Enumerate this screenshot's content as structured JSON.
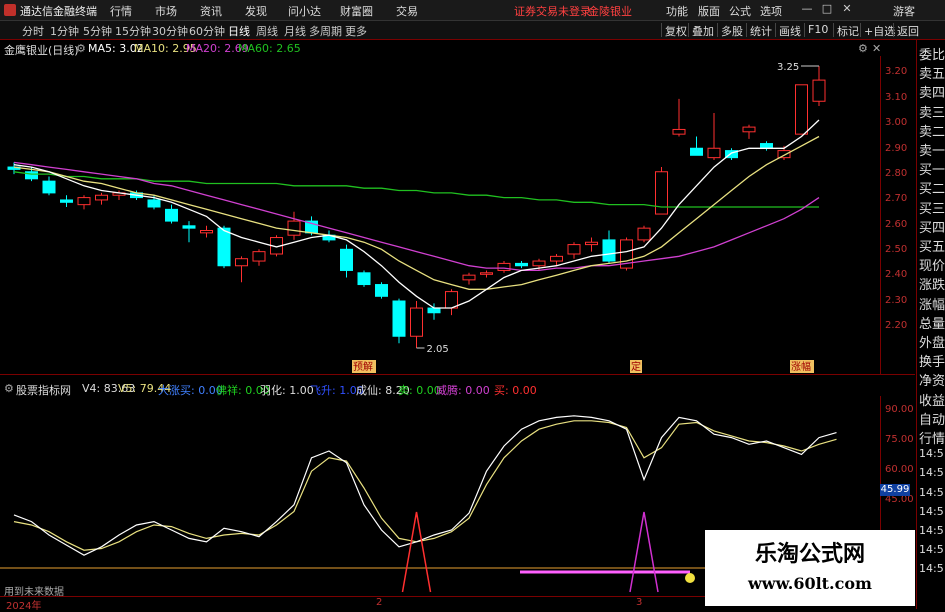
{
  "titlebar": {
    "app_name": "通达信金融终端",
    "menus": [
      "行情",
      "市场",
      "资讯",
      "发现",
      "问小达",
      "财富圈",
      "交易"
    ],
    "warning": "证券交易未登录",
    "stock_name": "金陵银业",
    "right_menus": [
      "功能",
      "版面",
      "公式",
      "选项"
    ],
    "toolbar_label": "游客"
  },
  "periods": {
    "items": [
      "分时",
      "1分钟",
      "5分钟",
      "15分钟",
      "30分钟",
      "60分钟",
      "日线",
      "周线",
      "月线",
      "多周期",
      "更多"
    ],
    "active": "日线"
  },
  "right_toolbar": [
    "复权",
    "叠加",
    "多股",
    "统计",
    "画线",
    "F10",
    "标记",
    "+自选",
    "返回"
  ],
  "main_info": {
    "title": "金鹰银业(日线)",
    "ma5": "MA5: 3.02",
    "ma10": "MA10: 2.95",
    "ma20": "MA20: 2.69",
    "ma60": "MA60: 2.65"
  },
  "colors": {
    "up": "#ff3030",
    "down": "#00ffff",
    "ma5": "#ffffff",
    "ma10": "#e8e080",
    "ma20": "#d040d0",
    "ma60": "#20c020"
  },
  "y_ticks_main": [
    "3.20",
    "3.10",
    "3.00",
    "2.90",
    "2.80",
    "2.70",
    "2.60",
    "2.50",
    "2.40",
    "2.30",
    "2.20"
  ],
  "annotations": {
    "high_label": "3.25",
    "low_label": "2.05",
    "badges": [
      "预解",
      "定",
      "涨幅"
    ]
  },
  "right_panel": [
    "委比",
    "卖五",
    "卖四",
    "卖三",
    "卖二",
    "卖一",
    "买一",
    "买二",
    "买三",
    "买四",
    "买五",
    "现价",
    "涨跌",
    "涨幅",
    "总量",
    "外盘",
    "换手",
    "净资",
    "收益",
    "自动",
    "行情",
    "14:5",
    "14:5",
    "14:5",
    "14:5",
    "14:5",
    "14:5",
    "14:5"
  ],
  "indicator_info": {
    "name": "股票指标网",
    "v4": "V4: 83.63",
    "v5": "V5: 79.44",
    "items": [
      {
        "label": "大涨买:",
        "value": "0.00",
        "color": "#4080ff"
      },
      {
        "label": "佛祥:",
        "value": "0.00",
        "color": "#20d020"
      },
      {
        "label": "羽化:",
        "value": "1.00",
        "color": "#dddddd"
      },
      {
        "label": "飞升:",
        "value": "1.00",
        "color": "#3050ff"
      },
      {
        "label": "成仙:",
        "value": "8.20",
        "color": "#dddddd"
      },
      {
        "label": "卖:",
        "value": "0.00",
        "color": "#20d020"
      },
      {
        "label": "威腾:",
        "value": "0.00",
        "color": "#d040d0"
      },
      {
        "label": "买:",
        "value": "0.00",
        "color": "#ff3030"
      }
    ]
  },
  "y_ticks_ind": [
    "90.00",
    "75.00",
    "60.00",
    "45.00"
  ],
  "current_value": "45.99",
  "dates": [
    "2024年",
    "2",
    "3"
  ],
  "no_data_text": "用到未来数据",
  "watermark": {
    "line1": "乐淘公式网",
    "line2": "www.60lt.com"
  },
  "chart_data": {
    "type": "candlestick",
    "title": "金鹰银业(日线)",
    "ylim": [
      2.05,
      3.25
    ],
    "candles": [
      {
        "o": 2.82,
        "h": 2.84,
        "l": 2.79,
        "c": 2.81
      },
      {
        "o": 2.8,
        "h": 2.82,
        "l": 2.76,
        "c": 2.77
      },
      {
        "o": 2.76,
        "h": 2.78,
        "l": 2.7,
        "c": 2.71
      },
      {
        "o": 2.68,
        "h": 2.7,
        "l": 2.65,
        "c": 2.67
      },
      {
        "o": 2.66,
        "h": 2.7,
        "l": 2.64,
        "c": 2.69
      },
      {
        "o": 2.68,
        "h": 2.71,
        "l": 2.66,
        "c": 2.7
      },
      {
        "o": 2.7,
        "h": 2.72,
        "l": 2.68,
        "c": 2.71
      },
      {
        "o": 2.71,
        "h": 2.72,
        "l": 2.68,
        "c": 2.69
      },
      {
        "o": 2.68,
        "h": 2.7,
        "l": 2.64,
        "c": 2.65
      },
      {
        "o": 2.64,
        "h": 2.66,
        "l": 2.58,
        "c": 2.59
      },
      {
        "o": 2.57,
        "h": 2.59,
        "l": 2.5,
        "c": 2.56
      },
      {
        "o": 2.54,
        "h": 2.57,
        "l": 2.52,
        "c": 2.55
      },
      {
        "o": 2.56,
        "h": 2.57,
        "l": 2.39,
        "c": 2.4
      },
      {
        "o": 2.4,
        "h": 2.44,
        "l": 2.33,
        "c": 2.43
      },
      {
        "o": 2.42,
        "h": 2.47,
        "l": 2.4,
        "c": 2.46
      },
      {
        "o": 2.45,
        "h": 2.53,
        "l": 2.44,
        "c": 2.52
      },
      {
        "o": 2.53,
        "h": 2.63,
        "l": 2.51,
        "c": 2.59
      },
      {
        "o": 2.59,
        "h": 2.61,
        "l": 2.53,
        "c": 2.54
      },
      {
        "o": 2.53,
        "h": 2.55,
        "l": 2.5,
        "c": 2.51
      },
      {
        "o": 2.47,
        "h": 2.49,
        "l": 2.35,
        "c": 2.38
      },
      {
        "o": 2.37,
        "h": 2.38,
        "l": 2.31,
        "c": 2.32
      },
      {
        "o": 2.32,
        "h": 2.33,
        "l": 2.26,
        "c": 2.27
      },
      {
        "o": 2.25,
        "h": 2.26,
        "l": 2.07,
        "c": 2.1
      },
      {
        "o": 2.1,
        "h": 2.25,
        "l": 2.05,
        "c": 2.22
      },
      {
        "o": 2.22,
        "h": 2.24,
        "l": 2.17,
        "c": 2.2
      },
      {
        "o": 2.22,
        "h": 2.3,
        "l": 2.19,
        "c": 2.29
      },
      {
        "o": 2.34,
        "h": 2.37,
        "l": 2.32,
        "c": 2.36
      },
      {
        "o": 2.37,
        "h": 2.38,
        "l": 2.35,
        "c": 2.37
      },
      {
        "o": 2.38,
        "h": 2.42,
        "l": 2.37,
        "c": 2.41
      },
      {
        "o": 2.41,
        "h": 2.42,
        "l": 2.39,
        "c": 2.4
      },
      {
        "o": 2.4,
        "h": 2.43,
        "l": 2.38,
        "c": 2.42
      },
      {
        "o": 2.42,
        "h": 2.45,
        "l": 2.4,
        "c": 2.44
      },
      {
        "o": 2.45,
        "h": 2.5,
        "l": 2.43,
        "c": 2.49
      },
      {
        "o": 2.49,
        "h": 2.52,
        "l": 2.46,
        "c": 2.5
      },
      {
        "o": 2.51,
        "h": 2.55,
        "l": 2.41,
        "c": 2.42
      },
      {
        "o": 2.39,
        "h": 2.52,
        "l": 2.38,
        "c": 2.51
      },
      {
        "o": 2.51,
        "h": 2.57,
        "l": 2.5,
        "c": 2.56
      },
      {
        "o": 2.62,
        "h": 2.82,
        "l": 2.62,
        "c": 2.8
      },
      {
        "o": 2.96,
        "h": 3.11,
        "l": 2.95,
        "c": 2.98
      },
      {
        "o": 2.9,
        "h": 2.95,
        "l": 2.87,
        "c": 2.87
      },
      {
        "o": 2.86,
        "h": 3.05,
        "l": 2.85,
        "c": 2.9
      },
      {
        "o": 2.89,
        "h": 2.9,
        "l": 2.85,
        "c": 2.86
      },
      {
        "o": 2.97,
        "h": 3.0,
        "l": 2.94,
        "c": 2.99
      },
      {
        "o": 2.92,
        "h": 2.93,
        "l": 2.89,
        "c": 2.9
      },
      {
        "o": 2.86,
        "h": 2.91,
        "l": 2.85,
        "c": 2.89
      },
      {
        "o": 2.96,
        "h": 3.17,
        "l": 2.96,
        "c": 3.17
      },
      {
        "o": 3.1,
        "h": 3.25,
        "l": 3.08,
        "c": 3.19
      }
    ],
    "ma5": [
      2.83,
      2.82,
      2.8,
      2.77,
      2.74,
      2.72,
      2.71,
      2.7,
      2.69,
      2.67,
      2.64,
      2.61,
      2.55,
      2.52,
      2.5,
      2.48,
      2.5,
      2.52,
      2.53,
      2.51,
      2.46,
      2.4,
      2.33,
      2.27,
      2.22,
      2.22,
      2.25,
      2.3,
      2.35,
      2.38,
      2.39,
      2.4,
      2.42,
      2.44,
      2.45,
      2.46,
      2.48,
      2.56,
      2.66,
      2.74,
      2.82,
      2.88,
      2.9,
      2.9,
      2.9,
      2.95,
      3.02
    ],
    "ma10": [
      2.82,
      2.81,
      2.8,
      2.78,
      2.76,
      2.75,
      2.73,
      2.71,
      2.7,
      2.68,
      2.66,
      2.64,
      2.62,
      2.6,
      2.58,
      2.56,
      2.55,
      2.54,
      2.53,
      2.52,
      2.5,
      2.47,
      2.42,
      2.38,
      2.34,
      2.32,
      2.3,
      2.3,
      2.31,
      2.32,
      2.34,
      2.36,
      2.38,
      2.4,
      2.41,
      2.42,
      2.44,
      2.48,
      2.54,
      2.6,
      2.66,
      2.72,
      2.78,
      2.83,
      2.87,
      2.91,
      2.95
    ],
    "ma20": [
      2.84,
      2.83,
      2.82,
      2.81,
      2.8,
      2.79,
      2.78,
      2.77,
      2.75,
      2.74,
      2.72,
      2.7,
      2.68,
      2.66,
      2.64,
      2.62,
      2.6,
      2.58,
      2.56,
      2.54,
      2.52,
      2.5,
      2.48,
      2.46,
      2.44,
      2.42,
      2.4,
      2.39,
      2.39,
      2.38,
      2.38,
      2.39,
      2.39,
      2.4,
      2.4,
      2.41,
      2.42,
      2.43,
      2.44,
      2.46,
      2.48,
      2.51,
      2.54,
      2.57,
      2.6,
      2.64,
      2.69
    ],
    "ma60": [
      2.8,
      2.79,
      2.79,
      2.78,
      2.78,
      2.77,
      2.77,
      2.77,
      2.76,
      2.76,
      2.76,
      2.75,
      2.75,
      2.75,
      2.75,
      2.75,
      2.74,
      2.74,
      2.74,
      2.74,
      2.73,
      2.73,
      2.72,
      2.72,
      2.71,
      2.71,
      2.7,
      2.7,
      2.69,
      2.69,
      2.68,
      2.68,
      2.67,
      2.67,
      2.66,
      2.66,
      2.66,
      2.65,
      2.65,
      2.65,
      2.65,
      2.65,
      2.65,
      2.65,
      2.65,
      2.65,
      2.65
    ],
    "indicator": {
      "ylim": [
        0,
        100
      ],
      "v4": [
        34,
        30,
        22,
        16,
        10,
        15,
        22,
        28,
        30,
        25,
        20,
        18,
        26,
        24,
        21,
        30,
        40,
        68,
        72,
        65,
        40,
        25,
        15,
        18,
        22,
        25,
        35,
        60,
        75,
        85,
        90,
        92,
        93,
        92,
        90,
        85,
        55,
        80,
        92,
        90,
        82,
        80,
        76,
        78,
        74,
        70,
        80,
        83
      ],
      "v5": [
        30,
        28,
        24,
        18,
        13,
        14,
        18,
        24,
        28,
        27,
        23,
        20,
        22,
        23,
        22,
        28,
        36,
        60,
        68,
        66,
        50,
        32,
        20,
        18,
        20,
        24,
        32,
        52,
        68,
        78,
        85,
        88,
        90,
        90,
        89,
        86,
        68,
        74,
        88,
        89,
        84,
        81,
        78,
        77,
        75,
        72,
        76,
        79
      ],
      "spikes": [
        {
          "index": 23,
          "color": "#ff3030"
        },
        {
          "index": 36,
          "color": "#d030d0"
        }
      ]
    }
  }
}
